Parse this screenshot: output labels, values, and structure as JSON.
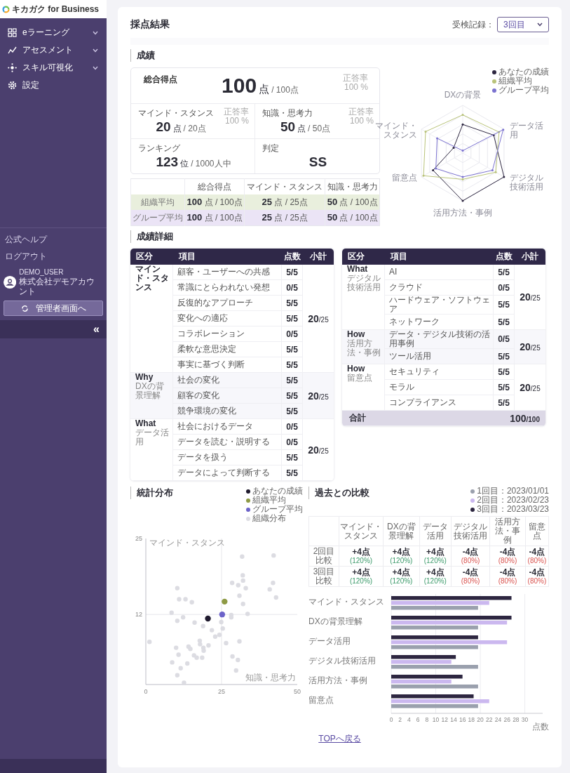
{
  "sidebar": {
    "logo": "キカガク for Business",
    "nav": [
      {
        "label": "eラーニング",
        "kind": "grid",
        "expandable": true
      },
      {
        "label": "アセスメント",
        "kind": "chart",
        "expandable": true
      },
      {
        "label": "スキル可視化",
        "kind": "skill",
        "expandable": true
      },
      {
        "label": "設定",
        "kind": "gear",
        "expandable": false
      }
    ],
    "links": [
      "公式ヘルプ",
      "ログアウト"
    ],
    "user": {
      "name": "DEMO_USER",
      "company": "株式会社デモアカウント"
    },
    "admin_button": "管理者画面へ",
    "collapse": "«"
  },
  "header": {
    "title": "採点結果",
    "record_label": "受検記録：",
    "record_value": "3回目"
  },
  "results": {
    "title": "成績",
    "cards": [
      {
        "label": "総合得点",
        "value": "100",
        "unit": "点",
        "max": "/ 100点",
        "rate_label": "正答率",
        "rate": "100 %",
        "kind": "main"
      },
      {
        "label": "マインド・スタンス",
        "value": "20",
        "unit": "点",
        "max": "/ 20点",
        "rate_label": "正答率",
        "rate": "100 %",
        "kind": "sub"
      },
      {
        "label": "知識・思考力",
        "value": "50",
        "unit": "点",
        "max": "/ 50点",
        "rate_label": "正答率",
        "rate": "100 %",
        "kind": "sub"
      },
      {
        "label": "ランキング",
        "value": "123",
        "unit": "位",
        "max": "/ 1000人中",
        "kind": "sub"
      },
      {
        "label": "判定",
        "value": "SS",
        "kind": "grade"
      }
    ],
    "averages": {
      "columns": [
        "総合得点",
        "マインド・スタンス",
        "知識・思考力"
      ],
      "rows": [
        {
          "label": "組織平均",
          "kind": "org",
          "cells": [
            {
              "value": "100",
              "rest": "点 / 100点"
            },
            {
              "value": "25",
              "rest": "点 / 25点"
            },
            {
              "value": "50",
              "rest": "点 / 100点"
            }
          ]
        },
        {
          "label": "グループ平均",
          "kind": "group",
          "cells": [
            {
              "value": "100",
              "rest": "点 / 100点"
            },
            {
              "value": "25",
              "rest": "点 / 25点"
            },
            {
              "value": "50",
              "rest": "点 / 100点"
            }
          ]
        }
      ]
    },
    "radar": {
      "legend": [
        {
          "label": "あなたの成績",
          "color": "#2d2640"
        },
        {
          "label": "組織平均",
          "color": "#b9c37a"
        },
        {
          "label": "グループ平均",
          "color": "#7b72d0"
        }
      ],
      "axes": [
        "DXの背景",
        "データ活用",
        "デジタル技術活用",
        "活用方法・事例",
        "留意点",
        "マインド・スタンス"
      ]
    }
  },
  "details": {
    "title": "成績詳細",
    "tables": [
      {
        "columns": [
          "区分",
          "項目",
          "点数",
          "小計"
        ],
        "groups": [
          {
            "category": "マインド・スタンス",
            "items": [
              {
                "name": "顧客・ユーザーへの共感",
                "score": "5/5"
              },
              {
                "name": "常識にとらわれない発想",
                "score": "0/5"
              },
              {
                "name": "反復的なアプローチ",
                "score": "5/5"
              },
              {
                "name": "変化への適応",
                "score": "5/5"
              },
              {
                "name": "コラボレーション",
                "score": "0/5"
              },
              {
                "name": "柔軟な意思決定",
                "score": "5/5"
              },
              {
                "name": "事実に基づく判断",
                "score": "5/5"
              }
            ],
            "subtotal": "20",
            "subtotal_max": "/25"
          },
          {
            "category": "Why",
            "sub": "DXの背景理解",
            "items": [
              {
                "name": "社会の変化",
                "score": "5/5"
              },
              {
                "name": "顧客の変化",
                "score": "5/5"
              },
              {
                "name": "競争環境の変化",
                "score": "5/5"
              }
            ],
            "subtotal": "20",
            "subtotal_max": "/25"
          },
          {
            "category": "What",
            "sub": "データ活用",
            "items": [
              {
                "name": "社会におけるデータ",
                "score": "0/5"
              },
              {
                "name": "データを読む・説明する",
                "score": "0/5"
              },
              {
                "name": "データを扱う",
                "score": "5/5"
              },
              {
                "name": "データによって判断する",
                "score": "5/5"
              }
            ],
            "subtotal": "20",
            "subtotal_max": "/25"
          }
        ]
      },
      {
        "columns": [
          "区分",
          "項目",
          "点数",
          "小計"
        ],
        "groups": [
          {
            "category": "What",
            "sub": "デジタル技術活用",
            "items": [
              {
                "name": "AI",
                "score": "5/5"
              },
              {
                "name": "クラウド",
                "score": "0/5"
              },
              {
                "name": "ハードウェア・ソフトウェア",
                "score": "5/5"
              },
              {
                "name": "ネットワーク",
                "score": "5/5"
              }
            ],
            "subtotal": "20",
            "subtotal_max": "/25"
          },
          {
            "category": "How",
            "sub": "活用方法・事例",
            "items": [
              {
                "name": "データ・デジタル技術の活用事例",
                "score": "0/5"
              },
              {
                "name": "ツール活用",
                "score": "5/5"
              }
            ],
            "subtotal": "20",
            "subtotal_max": "/25"
          },
          {
            "category": "How",
            "sub": "留意点",
            "items": [
              {
                "name": "セキュリティ",
                "score": "5/5"
              },
              {
                "name": "モラル",
                "score": "5/5"
              },
              {
                "name": "コンプライアンス",
                "score": "5/5"
              }
            ],
            "subtotal": "20",
            "subtotal_max": "/25"
          }
        ],
        "total": {
          "label": "合計",
          "value": "100",
          "max": "/100"
        }
      }
    ]
  },
  "distribution": {
    "title": "統計分布",
    "chart_data": {
      "type": "scatter",
      "xlabel": "知識・思考力",
      "ylabel": "マインド・スタンス",
      "xlim": [
        0,
        50
      ],
      "ylim": [
        0,
        25
      ],
      "xticks": [
        0,
        25,
        50
      ],
      "yticks": [
        12,
        25
      ],
      "series": [
        {
          "name": "あなたの成績",
          "color": "#1f1a2e",
          "x": [
            20.5
          ],
          "values": [
            11.3
          ]
        },
        {
          "name": "組織平均",
          "color": "#8e9a45",
          "x": [
            26
          ],
          "values": [
            14.2
          ]
        },
        {
          "name": "グループ平均",
          "color": "#6c63c9",
          "x": [
            25.2
          ],
          "values": [
            12
          ]
        },
        {
          "name": "組織分布",
          "color": "#dcdce2",
          "x": [
            1.2,
            10.4,
            11,
            13.1,
            15.2,
            8.5,
            10.4,
            12.3,
            16.1,
            18.9,
            21.8,
            22.9,
            24.3,
            24.9,
            25.4,
            20.7,
            17.8,
            17.9,
            19,
            19.1,
            14.1,
            14.7,
            10,
            10.8,
            8.7,
            11.5,
            10.4,
            12.6,
            13.7,
            15.9,
            16.8,
            18.6,
            26.5,
            28.6,
            30.4,
            29.8,
            30.9,
            28.2,
            28.2,
            33.6,
            32.1,
            30.9,
            30.5,
            28.5,
            33,
            32.1,
            32,
            31.8,
            42.2,
            42,
            40.9,
            43
          ],
          "values": [
            7.3,
            16.5,
            14.6,
            14.6,
            14.1,
            12.3,
            10.9,
            11.5,
            10.6,
            10,
            9.3,
            8.2,
            8.5,
            10.7,
            9.6,
            6.7,
            7.5,
            6.9,
            6.3,
            5.8,
            6.5,
            6.1,
            6.3,
            5.1,
            3.8,
            2.8,
            1.6,
            0.3,
            3.6,
            5,
            4.6,
            4.6,
            7.1,
            4.8,
            4.2,
            2.4,
            7.4,
            11.9,
            11.5,
            12.1,
            13.8,
            15.2,
            17,
            17.4,
            16.5,
            17.8,
            18.7,
            21.9,
            22.1,
            17.4,
            16.3,
            14.9
          ]
        }
      ]
    }
  },
  "comparison": {
    "title": "過去との比較",
    "table": {
      "columns": [
        "マインド・スタンス",
        "DXの背景理解",
        "データ活用",
        "デジタル技術活用",
        "活用方法・事例",
        "留意点"
      ],
      "rows": [
        {
          "label": "2回目比較",
          "cells": [
            {
              "diff": "+4点",
              "pct": "(120%)",
              "increase": true
            },
            {
              "diff": "+4点",
              "pct": "(120%)",
              "increase": true
            },
            {
              "diff": "+4点",
              "pct": "(120%)",
              "increase": true
            },
            {
              "diff": "-4点",
              "pct": "(80%)",
              "increase": false
            },
            {
              "diff": "-4点",
              "pct": "(80%)",
              "increase": false
            },
            {
              "diff": "-4点",
              "pct": "(80%)",
              "increase": false
            }
          ]
        },
        {
          "label": "3回目比較",
          "cells": [
            {
              "diff": "+4点",
              "pct": "(120%)",
              "increase": true
            },
            {
              "diff": "+4点",
              "pct": "(120%)",
              "increase": true
            },
            {
              "diff": "+4点",
              "pct": "(120%)",
              "increase": true
            },
            {
              "diff": "-4点",
              "pct": "(80%)",
              "increase": false
            },
            {
              "diff": "-4点",
              "pct": "(80%)",
              "increase": false
            },
            {
              "diff": "-4点",
              "pct": "(80%)",
              "increase": false
            }
          ]
        }
      ]
    },
    "chart_data": {
      "type": "bar",
      "orientation": "horizontal",
      "grid": true,
      "xlabel": "点数",
      "xlim": [
        0,
        34
      ],
      "xticks": [
        0,
        2,
        4,
        6,
        8,
        10,
        12,
        14,
        16,
        18,
        20,
        22,
        24,
        26,
        28,
        30
      ],
      "categories": [
        "マインド・スタンス",
        "DXの背景理解",
        "データ活用",
        "デジタル技術活用",
        "活用方法・事例",
        "留意点"
      ],
      "series": [
        {
          "name": "1回目：2023/01/01",
          "color": "#9aa0ad",
          "values": [
            19.5,
            19.5,
            19.5,
            19.5,
            19.5,
            19.5
          ]
        },
        {
          "name": "2回目：2023/02/23",
          "color": "#cbb8ef",
          "values": [
            22,
            26,
            26,
            13.5,
            13.5,
            22
          ]
        },
        {
          "name": "3回目：2023/03/23",
          "color": "#2d2640",
          "values": [
            27,
            27,
            19.5,
            14.5,
            16,
            18.5
          ]
        }
      ]
    }
  },
  "footer_link": "TOPへ戻る"
}
